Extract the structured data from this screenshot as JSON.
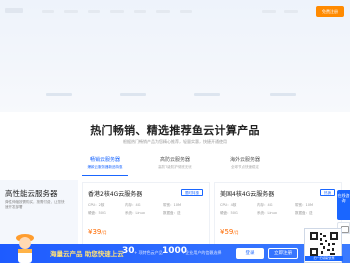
{
  "header": {
    "cta_label": "免费注册"
  },
  "products": {
    "title": "热门畅销、精选推荐鱼云计算产品",
    "subtitle": "根据热门畅销产品为您精心推荐，轻量实惠，快捷开通使用",
    "tabs": [
      {
        "label": "畅销云服务器",
        "sub": "爆款云服务器新品特惠",
        "active": true
      },
      {
        "label": "高防云服务器",
        "sub": "高防T级防护彻底无忧",
        "active": false
      },
      {
        "label": "海外云服务器",
        "sub": "全球节点快速稳定",
        "active": false
      }
    ]
  },
  "feature": {
    "title": "高性能云服务器",
    "desc": "弹性伸缩按需购买，按需付费，让您快速开发部署"
  },
  "cards": [
    {
      "title": "香港2核4G云服务器",
      "badge": "限时特惠",
      "specs": [
        "CPU：2核",
        "内存：4G",
        "带宽：10M",
        "硬盘：50G",
        "系统：Linux",
        "数据盘：送"
      ],
      "price": "¥39",
      "unit": "/月"
    },
    {
      "title": "美国4核4G云服务器",
      "badge": "热销",
      "specs": [
        "CPU：4核",
        "内存：4G",
        "带宽：10M",
        "硬盘：50G",
        "系统：Linux",
        "数据盘：送"
      ],
      "price": "¥59",
      "unit": "/月"
    }
  ],
  "sidebar": {
    "label": "在线咨询"
  },
  "promo": {
    "title": "海量云产品 助您快速上云",
    "stat1_value": "30",
    "stat1_label": "+ 项特色云产品",
    "stat2_value": "1000",
    "stat2_label": "+企业用户的信赖选择",
    "login_label": "登录",
    "register_label": "立即注册"
  },
  "qr": {
    "caption": "扫一扫领取优惠"
  }
}
